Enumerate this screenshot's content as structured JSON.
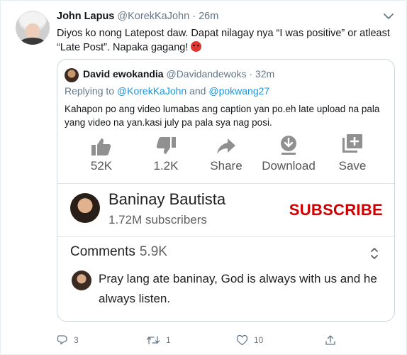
{
  "tweet": {
    "author_name": "John Lapus",
    "author_handle": "@KorekKaJohn",
    "separator": "·",
    "time": "26m",
    "text": "Diyos ko nong Latepost daw. Dapat nilagay nya “I was positive” or atleast “Late Post”. Napaka gagang!",
    "emoji": "angry-face"
  },
  "quote": {
    "author_name": "David ewokandia",
    "author_handle": "@Davidandewoks",
    "separator": "·",
    "time": "32m",
    "replying_prefix": "Replying to",
    "replying_to_1": "@KorekKaJohn",
    "replying_and": "and",
    "replying_to_2": "@pokwang27",
    "text": "Kahapon po ang video lumabas ang caption yan po.eh late upload na pala yang video na yan.kasi july pa pala sya nag posi."
  },
  "youtube": {
    "actions": [
      {
        "icon": "thumbs-up-icon",
        "label": "52K"
      },
      {
        "icon": "thumbs-down-icon",
        "label": "1.2K"
      },
      {
        "icon": "share-icon",
        "label": "Share"
      },
      {
        "icon": "download-icon",
        "label": "Download"
      },
      {
        "icon": "save-icon",
        "label": "Save"
      }
    ],
    "channel_name": "Baninay Bautista",
    "subscribers": "1.72M subscribers",
    "subscribe_label": "SUBSCRIBE",
    "comments_label": "Comments",
    "comments_count": "5.9K",
    "top_comment": "Pray lang ate baninay, God is always with us and he always listen."
  },
  "action_bar": {
    "replies": "3",
    "retweets": "1",
    "likes": "10"
  },
  "colors": {
    "link": "#1b95e0",
    "muted": "#657786",
    "subscribe_red": "#cc0000"
  }
}
